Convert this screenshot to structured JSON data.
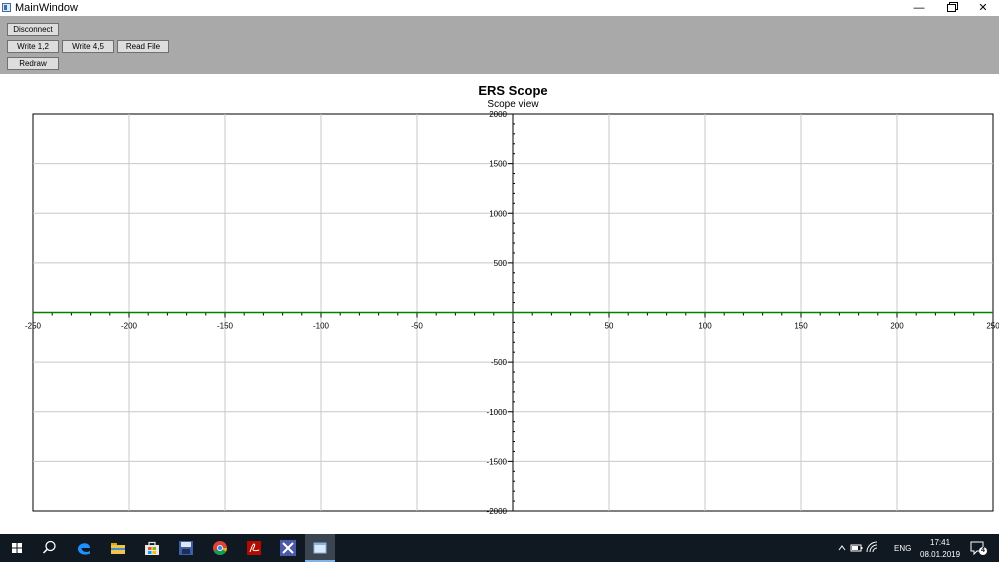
{
  "window": {
    "title": "MainWindow",
    "controls": {
      "minimize": "—",
      "close": "✕"
    }
  },
  "toolbar": {
    "disconnect": "Disconnect",
    "write12": "Write 1,2",
    "write45": "Write 4,5",
    "read_file": "Read File",
    "redraw": "Redraw"
  },
  "chart_data": {
    "type": "line",
    "title": "ERS Scope",
    "subtitle": "Scope view",
    "xlabel": "",
    "ylabel": "",
    "xlim": [
      -250,
      250
    ],
    "ylim": [
      -2000,
      2000
    ],
    "x_ticks": [
      -250,
      -200,
      -150,
      -100,
      -50,
      50,
      100,
      150,
      200,
      250
    ],
    "y_ticks": [
      2000,
      1500,
      1000,
      500,
      -500,
      -1000,
      -1500,
      -2000
    ],
    "grid": true,
    "series": [
      {
        "color": "#008000",
        "x": [
          -250,
          -200,
          -150,
          -100,
          -50,
          0,
          50,
          100,
          150,
          200,
          250
        ],
        "y": [
          0,
          0,
          0,
          0,
          0,
          0,
          0,
          0,
          0,
          0,
          0
        ]
      }
    ]
  },
  "taskbar": {
    "apps": [
      "start-icon",
      "search-icon",
      "edge-icon",
      "file-explorer-icon",
      "store-icon",
      "save-disk-icon",
      "chrome-icon",
      "pdf-icon",
      "visual-studio-icon",
      "mainwindow-app-icon"
    ],
    "language": "ENG",
    "time": "17:41",
    "date": "08.01.2019",
    "notifications": "4"
  }
}
